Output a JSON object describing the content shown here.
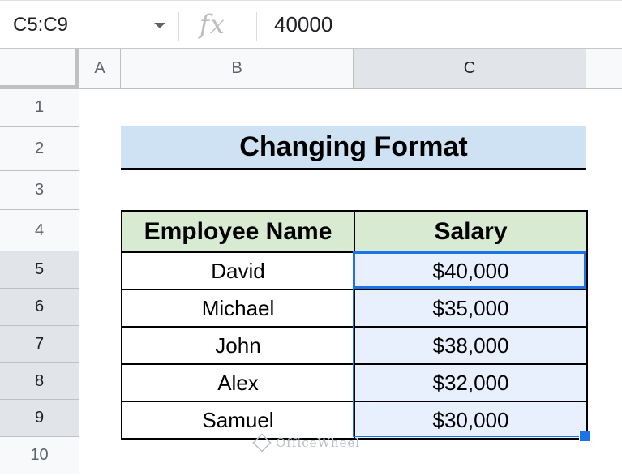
{
  "formula_bar": {
    "name_box": "C5:C9",
    "fx_label": "fx",
    "formula_value": "40000"
  },
  "column_headers": [
    "A",
    "B",
    "C"
  ],
  "row_headers": [
    "1",
    "2",
    "3",
    "4",
    "5",
    "6",
    "7",
    "8",
    "9",
    "10"
  ],
  "title": "Changing Format",
  "table": {
    "headers": [
      "Employee Name",
      "Salary"
    ],
    "rows": [
      {
        "name": "David",
        "salary": "$40,000"
      },
      {
        "name": "Michael",
        "salary": "$35,000"
      },
      {
        "name": "John",
        "salary": "$38,000"
      },
      {
        "name": "Alex",
        "salary": "$32,000"
      },
      {
        "name": "Samuel",
        "salary": "$30,000"
      }
    ]
  },
  "watermark": "OfficeWheel",
  "colors": {
    "title_fill": "#cfe2f3",
    "header_fill": "#d9ead3",
    "selection": "#1a73e8"
  }
}
